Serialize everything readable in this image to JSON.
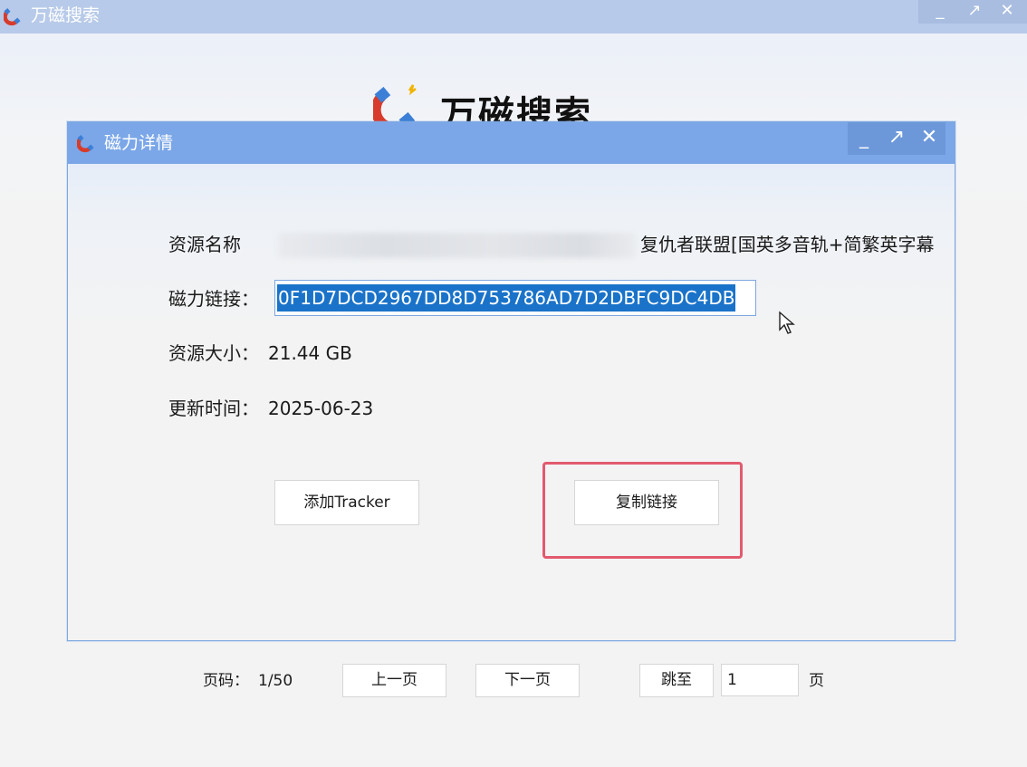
{
  "app": {
    "title": "万磁搜索",
    "logo_text": "万磁搜索",
    "window_buttons": {
      "minimize": "_",
      "maximize": "↗",
      "close": "✕"
    }
  },
  "dialog": {
    "title": "磁力详情",
    "window_buttons": {
      "minimize": "_",
      "maximize": "↗",
      "close": "✕"
    },
    "fields": {
      "name_label": "资源名称",
      "name_value_visible": "复仇者联盟[国英多音轨+简繁英字幕",
      "magnet_label": "磁力链接：",
      "magnet_value": "0F1D7DCD2967DD8D753786AD7D2DBFC9DC4DB",
      "size_label": "资源大小：",
      "size_value": "21.44 GB",
      "updated_label": "更新时间：",
      "updated_value": "2025-06-23"
    },
    "buttons": {
      "add_tracker": "添加Tracker",
      "copy_link": "复制链接"
    }
  },
  "pager": {
    "page_label": "页码：",
    "page_value": "1/50",
    "prev": "上一页",
    "next": "下一页",
    "jump": "跳至",
    "input_value": "1",
    "unit": "页"
  },
  "colors": {
    "titlebar": "#b7cae9",
    "dialog_titlebar": "#7ba7e8",
    "selection": "#1a73c9",
    "highlight": "#e25a6e"
  },
  "icons": [
    "magnet-icon",
    "minimize-icon",
    "maximize-icon",
    "close-icon",
    "mouse-cursor-icon"
  ]
}
